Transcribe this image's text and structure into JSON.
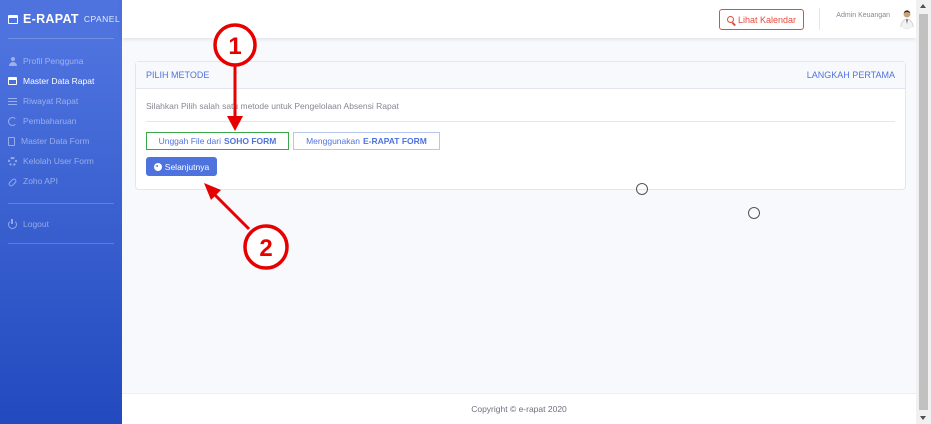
{
  "brand": {
    "title": "E-RAPAT",
    "subtitle": "CPANEL"
  },
  "sidebar": {
    "items": [
      {
        "label": "Profil Pengguna",
        "icon": "user-icon"
      },
      {
        "label": "Master Data Rapat",
        "icon": "calendar-icon",
        "active": true
      },
      {
        "label": "Riwayat Rapat",
        "icon": "list-icon"
      },
      {
        "label": "Pembaharuan",
        "icon": "sync-icon"
      },
      {
        "label": "Master Data Form",
        "icon": "file-icon"
      },
      {
        "label": "Kelolah User Form",
        "icon": "gear-icon"
      },
      {
        "label": "Zoho API",
        "icon": "link-icon"
      }
    ],
    "logout": {
      "label": "Logout",
      "icon": "power-icon"
    }
  },
  "topbar": {
    "calendar_button": "Lihat Kalendar",
    "user_name": "Admin Keuangan"
  },
  "card": {
    "header_left": "PILIH METODE",
    "header_right": "LANGKAH PERTAMA",
    "instruction": "Silahkan Pilih salah satu metode untuk Pengelolaan Absensi Rapat",
    "methods": [
      {
        "prefix": "Unggah File dari",
        "bold": "SOHO FORM",
        "selected": true
      },
      {
        "prefix": "Menggunakan",
        "bold": "E-RAPAT FORM",
        "selected": false
      }
    ],
    "next_button": "Selanjutnya"
  },
  "annotations": [
    {
      "number": "1"
    },
    {
      "number": "2"
    }
  ],
  "footer": {
    "copyright": "Copyright © e-rapat 2020"
  },
  "colors": {
    "primary": "#4e73df",
    "accent_red": "#e74a3b",
    "selected_border": "#3aa84a",
    "annotation": "#e60000"
  }
}
